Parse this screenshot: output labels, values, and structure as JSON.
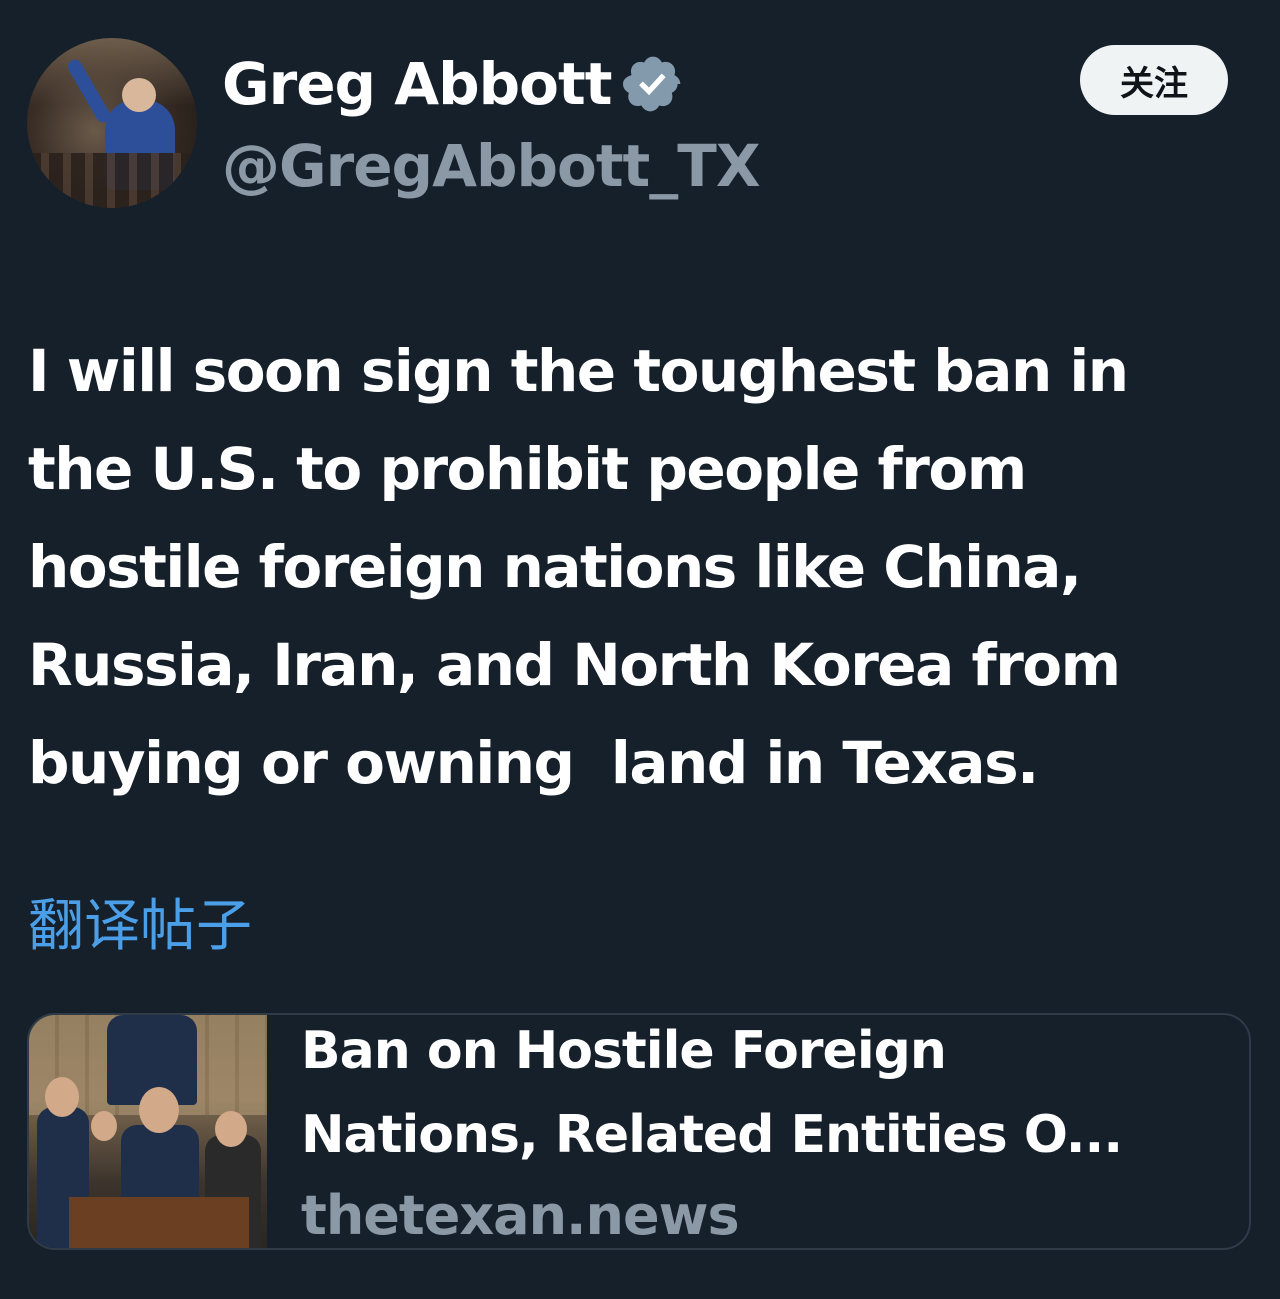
{
  "author": {
    "name": "Greg Abbott",
    "handle": "@GregAbbott_TX",
    "verified": true,
    "verified_color": "#829aab"
  },
  "follow_button": {
    "label": "关注"
  },
  "tweet": {
    "lines": [
      "I will soon sign the toughest ban in",
      "the U.S. to prohibit people from",
      "hostile foreign nations like China,",
      "Russia, Iran, and North Korea from",
      "buying or owning  land in Texas."
    ]
  },
  "translate_link": {
    "label": "翻译帖子",
    "color": "#4b9fe8"
  },
  "link_card": {
    "title_lines": [
      "Ban on Hostile Foreign",
      "Nations, Related Entities O..."
    ],
    "domain": "thetexan.news"
  },
  "colors": {
    "background": "#16202b",
    "text_primary": "#ffffff",
    "text_secondary": "#8b98a5",
    "card_border": "#2f3b47"
  }
}
